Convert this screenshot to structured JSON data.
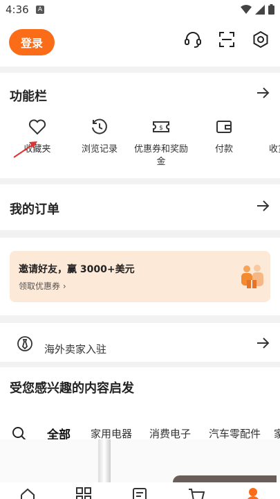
{
  "status": {
    "time": "4:36",
    "notification": "A"
  },
  "header": {
    "login_label": "登录"
  },
  "function_bar": {
    "title": "功能栏",
    "items": [
      {
        "label": "收藏夹",
        "icon": "heart-icon"
      },
      {
        "label": "浏览记录",
        "icon": "history-icon"
      },
      {
        "label": "优惠券和奖励金",
        "icon": "coupon-icon"
      },
      {
        "label": "付款",
        "icon": "wallet-icon"
      },
      {
        "label": "收货",
        "icon": "package-icon"
      }
    ]
  },
  "orders": {
    "title": "我的订单"
  },
  "invite": {
    "title": "邀请好友，赢 3000+美元",
    "subtitle": "领取优惠券 ›"
  },
  "seller": {
    "label": "海外卖家入驻"
  },
  "interest": {
    "title": "受您感兴趣的内容启发",
    "tabs": [
      "全部",
      "家用电器",
      "消费电子",
      "汽车零配件",
      "家居"
    ],
    "active_tab": "全部"
  },
  "colors": {
    "accent": "#fa6c17",
    "invite_bg": "#fde9d8"
  }
}
